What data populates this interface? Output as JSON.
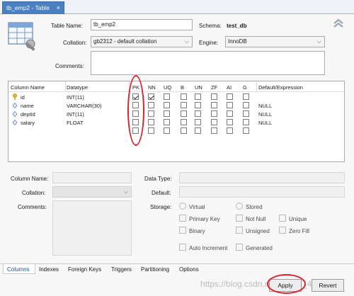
{
  "tab": {
    "title": "tb_emp2 - Table",
    "close": "×"
  },
  "form": {
    "table_name_label": "Table Name:",
    "table_name_value": "tb_emp2",
    "schema_label": "Schema:",
    "schema_value": "test_db",
    "collation_label": "Collation:",
    "collation_value": "gb2312 - default collation",
    "engine_label": "Engine:",
    "engine_value": "InnoDB",
    "comments_label": "Comments:"
  },
  "grid": {
    "headers": [
      "Column Name",
      "Datatype",
      "PK",
      "NN",
      "UQ",
      "B",
      "UN",
      "ZF",
      "AI",
      "G",
      "Default/Expression"
    ],
    "rows": [
      {
        "name": "id",
        "type": "INT(11)",
        "default": "",
        "icon": "key-icon",
        "checks": [
          true,
          true,
          false,
          false,
          false,
          false,
          false,
          false
        ]
      },
      {
        "name": "name",
        "type": "VARCHAR(30)",
        "default": "NULL",
        "icon": "diamond-icon",
        "checks": [
          false,
          false,
          false,
          false,
          false,
          false,
          false,
          false
        ]
      },
      {
        "name": "deptId",
        "type": "INT(11)",
        "default": "NULL",
        "icon": "diamond-icon",
        "checks": [
          false,
          false,
          false,
          false,
          false,
          false,
          false,
          false
        ]
      },
      {
        "name": "salary",
        "type": "FLOAT",
        "default": "NULL",
        "icon": "diamond-icon",
        "checks": [
          false,
          false,
          false,
          false,
          false,
          false,
          false,
          false
        ]
      },
      {
        "name": "",
        "type": "",
        "default": "",
        "icon": "",
        "checks": [
          false,
          false,
          false,
          false,
          false,
          false,
          false,
          false
        ]
      }
    ]
  },
  "details": {
    "column_name_label": "Column Name:",
    "data_type_label": "Data Type:",
    "collation_label": "Collation:",
    "default_label": "Default:",
    "comments_label": "Comments:",
    "storage_label": "Storage:",
    "virtual": "Virtual",
    "stored": "Stored",
    "primary_key": "Primary Key",
    "not_null": "Not Null",
    "unique": "Unique",
    "binary": "Binary",
    "unsigned": "Unsigned",
    "zero_fill": "Zero Fill",
    "auto_increment": "Auto Increment",
    "generated": "Generated"
  },
  "bottom_tabs": [
    "Columns",
    "Indexes",
    "Foreign Keys",
    "Triggers",
    "Partitioning",
    "Options"
  ],
  "buttons": {
    "apply": "Apply",
    "revert": "Revert"
  },
  "watermark": "https://blog.csdn.net/weixin_4..."
}
